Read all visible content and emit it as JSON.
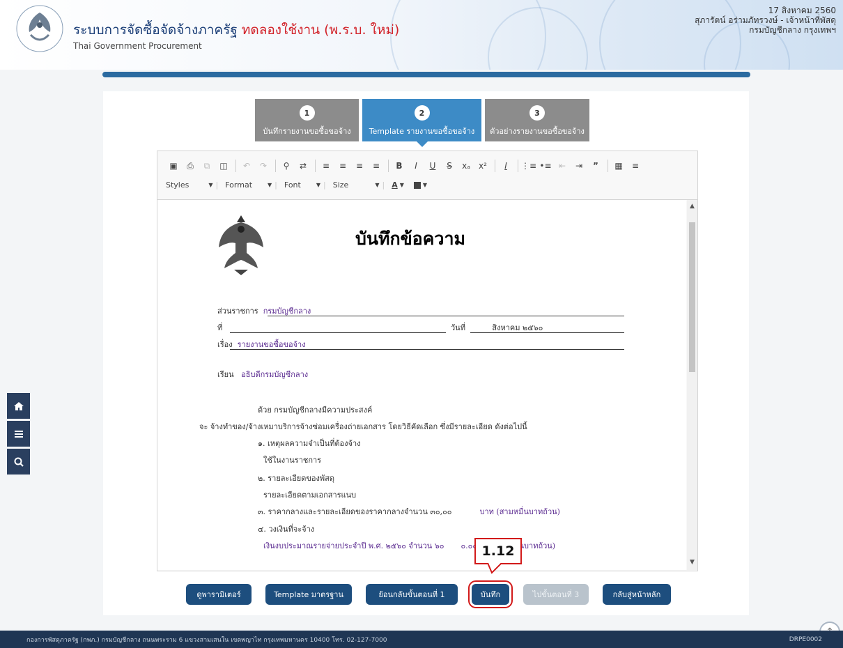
{
  "header": {
    "title": "ระบบการจัดซื้อจัดจ้างภาครัฐ",
    "trial": "ทดลองใช้งาน (พ.ร.บ. ใหม่)",
    "subtitle": "Thai Government Procurement",
    "date": "17 สิงหาคม 2560",
    "user": "สุภารัตน์ อร่ามภัทรวงษ์ - เจ้าหน้าที่พัสดุ",
    "org": "กรมบัญชีกลาง กรุงเทพฯ"
  },
  "steps": [
    {
      "num": "1",
      "label": "บันทึกรายงานขอซื้อขอจ้าง"
    },
    {
      "num": "2",
      "label": "Template รายงานขอซื้อขอจ้าง"
    },
    {
      "num": "3",
      "label": "ตัวอย่างรายงานขอซื้อขอจ้าง"
    }
  ],
  "toolbar": {
    "styles": "Styles",
    "format": "Format",
    "font": "Font",
    "size": "Size"
  },
  "document": {
    "title": "บันทึกข้อความ",
    "dept_label": "ส่วนราชการ",
    "dept_value": "กรมบัญชีกลาง",
    "ref_label": "ที่",
    "date_label": "วันที่",
    "date_value": "สิงหาคม ๒๕๖๐",
    "subject_label": "เรื่อง",
    "subject_value": "รายงานขอซื้อขอจ้าง",
    "to_label": "เรียน",
    "to_value": "อธิบดีกรมบัญชีกลาง",
    "intro": "ด้วย กรมบัญชีกลางมีความประสงค์",
    "intro2": "จะ จ้างทำของ/จ้างเหมาบริการจ้างซ่อมเครื่องถ่ายเอกสาร โดยวิธีคัดเลือก ซึ่งมีรายละเอียด ดังต่อไปนี้",
    "item1": "๑. เหตุผลความจำเป็นที่ต้องจ้าง",
    "item1_val": "ใช้ในงานราชการ",
    "item2": "๒. รายละเอียดของพัสดุ",
    "item2_val": "รายละเอียดตามเอกสารแนบ",
    "item3_pre": "๓. ราคากลางและรายละเอียดของราคากลางจำนวน ๓๐,๐๐",
    "item3_post": "บาท (สามหมื่นบาทถ้วน)",
    "item4": "๔. วงเงินที่จะจ้าง",
    "item4_val_pre": "เงินงบประมาณรายจ่ายประจำปี พ.ศ. ๒๕๖๐ จำนวน ๖๐",
    "item4_val_post": "๐.๐๐ บาท (หกแสนบาทถ้วน)"
  },
  "callout": "1.12",
  "buttons": {
    "params": "ดูพารามิเตอร์",
    "template": "Template มาตรฐาน",
    "back": "ย้อนกลับขั้นตอนที่ 1",
    "save": "บันทึก",
    "next": "ไปขั้นตอนที่ 3",
    "home": "กลับสู่หน้าหลัก"
  },
  "footer": {
    "address": "กองการพัสดุภาครัฐ (กพภ.) กรมบัญชีกลาง ถนนพระราม 6 แขวงสามเสนใน เขตพญาไท กรุงเทพมหานคร 10400 โทร. 02-127-7000",
    "code": "DRPE0002"
  }
}
